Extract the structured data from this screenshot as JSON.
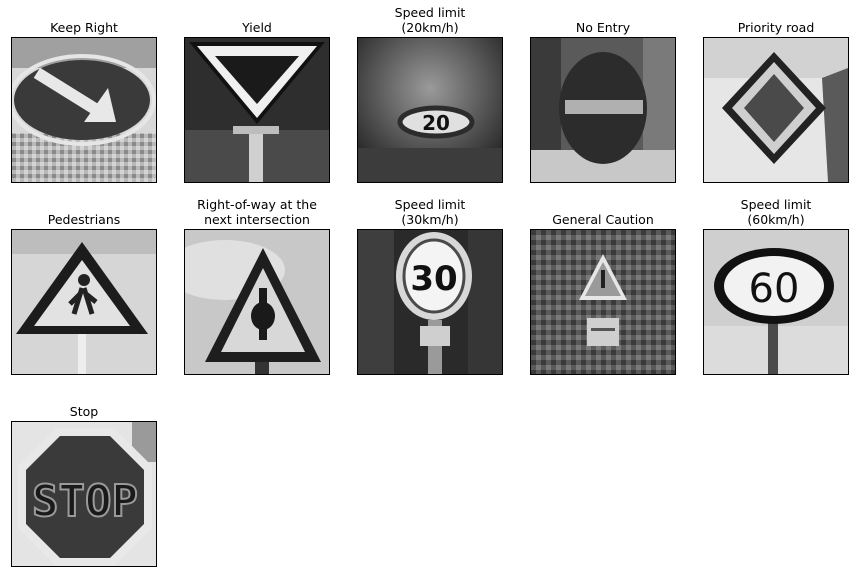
{
  "figure": {
    "panels": [
      {
        "label": "Keep Right",
        "icon": "keep-right-sign-icon"
      },
      {
        "label": "Yield",
        "icon": "yield-sign-icon"
      },
      {
        "label": "Speed limit\n(20km/h)",
        "icon": "speed-limit-20-sign-icon"
      },
      {
        "label": "No Entry",
        "icon": "no-entry-sign-icon"
      },
      {
        "label": "Priority road",
        "icon": "priority-road-sign-icon"
      },
      {
        "label": "Pedestrians",
        "icon": "pedestrians-sign-icon"
      },
      {
        "label": "Right-of-way at the\nnext intersection",
        "icon": "right-of-way-sign-icon"
      },
      {
        "label": "Speed limit\n(30km/h)",
        "icon": "speed-limit-30-sign-icon"
      },
      {
        "label": "General Caution",
        "icon": "general-caution-sign-icon"
      },
      {
        "label": "Speed limit\n(60km/h)",
        "icon": "speed-limit-60-sign-icon"
      },
      {
        "label": "Stop",
        "icon": "stop-sign-icon"
      }
    ]
  },
  "colors": {
    "frame_border": "#000000",
    "background": "#ffffff"
  }
}
